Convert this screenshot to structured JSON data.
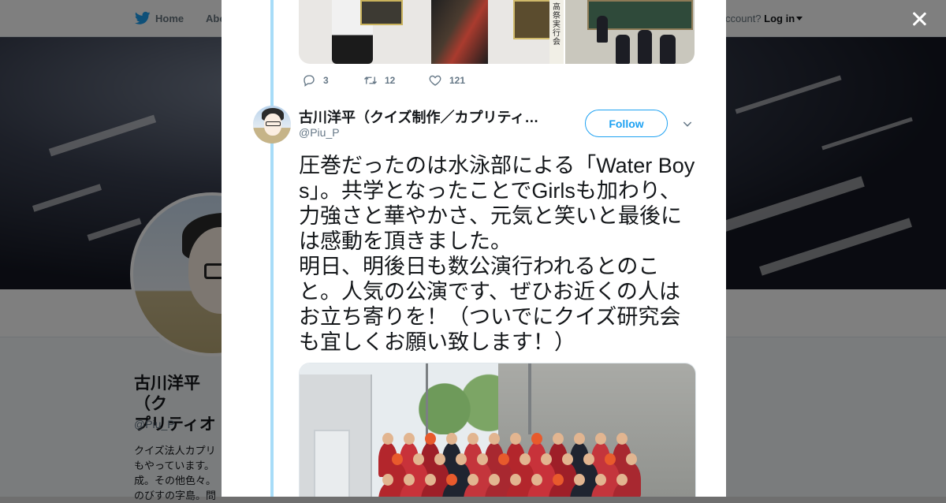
{
  "background_page": {
    "nav": {
      "home_label": "Home",
      "about_label": "Abo",
      "account_prompt": "ccount?",
      "login_label": "Log in"
    },
    "profile": {
      "name_line1": "古川洋平（ク",
      "name_line2": "プリティオ",
      "handle": "@Piu_P",
      "bio_line1": "クイズ法人カプリ",
      "bio_line2": "もやっています。",
      "bio_line3": "成。その他色々。",
      "bio_line4": "のびすの字島。問"
    }
  },
  "modal": {
    "close_label": "Close",
    "previous_tweet": {
      "photo_strip_text": "高祭実行会",
      "actions": {
        "reply_count": "3",
        "retweet_count": "12",
        "like_count": "121"
      }
    },
    "tweet": {
      "author_name": "古川洋平（クイズ制作／カプリティ…",
      "author_handle": "@Piu_P",
      "follow_label": "Follow",
      "text": "圧巻だったのは水泳部による「Water Boys」。共学となったことでGirlsも加わり、力強さと華やかさ、元気と笑いと最後には感動を頂きました。\n明日、明後日も数公演行われるとのこと。人気の公演です、ぜひお近くの人はお立ち寄りを！（ついでにクイズ研究会も宜しくお願い致します！）"
    }
  },
  "colors": {
    "brand_blue": "#1da1f2",
    "thread_line": "#a7dcf8",
    "text_primary": "#14171a",
    "text_secondary": "#657786"
  },
  "icons": {
    "nav_logo": "twitter-bird-icon",
    "reply": "reply-icon",
    "retweet": "retweet-icon",
    "like": "heart-icon",
    "more": "chevron-down-icon",
    "close": "close-icon"
  }
}
